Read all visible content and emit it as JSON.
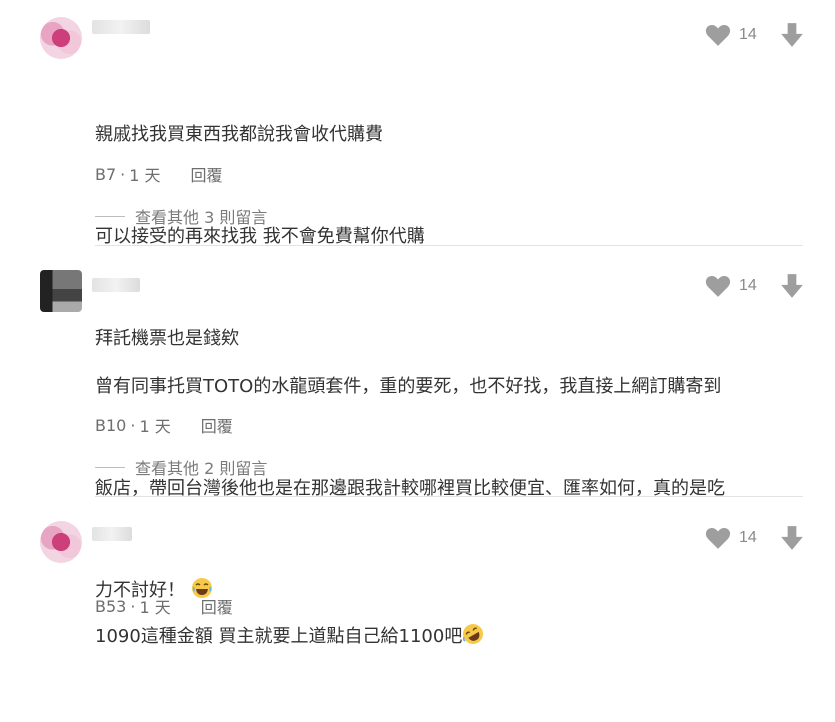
{
  "icons": {
    "like": "heart-icon",
    "dislike": "arrow-down-icon",
    "colors": {
      "icon": "#9e9e9e",
      "emoji": "#f7c948"
    }
  },
  "comments": [
    {
      "lines": [
        "親戚找我買東西我都說我會收代購費",
        "可以接受的再來找我 我不會免費幫你代購",
        "拜託機票也是錢欸"
      ],
      "likes": "14",
      "floor": "B7",
      "time": "1 天",
      "reply": "回覆",
      "more": "查看其他 3 則留言"
    },
    {
      "lines": [
        "曾有同事托買TOTO的水龍頭套件，重的要死，也不好找，我直接上網訂購寄到",
        "飯店，帶回台灣後他也是在那邊跟我計較哪裡買比較便宜、匯率如何，真的是吃",
        "力不討好！"
      ],
      "likes": "14",
      "floor": "B10",
      "time": "1 天",
      "reply": "回覆",
      "more": "查看其他 2 則留言"
    },
    {
      "lines": [
        "1090這種金額 買主就要上道點自己給1100吧"
      ],
      "likes": "14",
      "floor": "B53",
      "time": "1 天",
      "reply": "回覆"
    }
  ]
}
